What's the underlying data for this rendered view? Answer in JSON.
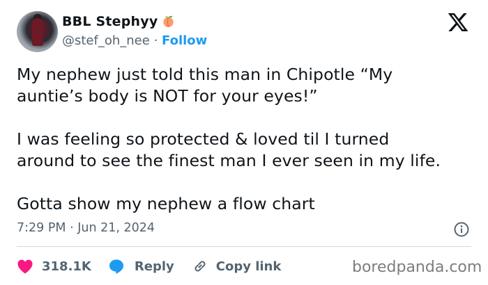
{
  "author": {
    "display_name": "BBL Stephyy",
    "emoji_icon": "peach-icon",
    "handle": "@stef_oh_nee",
    "separator": "·",
    "follow_label": "Follow"
  },
  "platform_logo": "x-logo-icon",
  "tweet": {
    "lines": [
      "My nephew just told this man in Chipotle “My",
      "auntie’s body is NOT for your eyes!”",
      "",
      "I was feeling so protected & loved til I turned",
      "around to see the finest man I ever seen in my life.",
      "",
      "Gotta show my nephew a flow chart"
    ]
  },
  "timestamp": "7:29 PM · Jun 21, 2024",
  "actions": {
    "likes_count": "318.1K",
    "reply_label": "Reply",
    "copy_link_label": "Copy link"
  },
  "watermark": "boredpanda.com",
  "colors": {
    "link_blue": "#1d9bf0",
    "like_pink": "#f91880",
    "muted_gray": "#536471",
    "text": "#0f1419"
  }
}
